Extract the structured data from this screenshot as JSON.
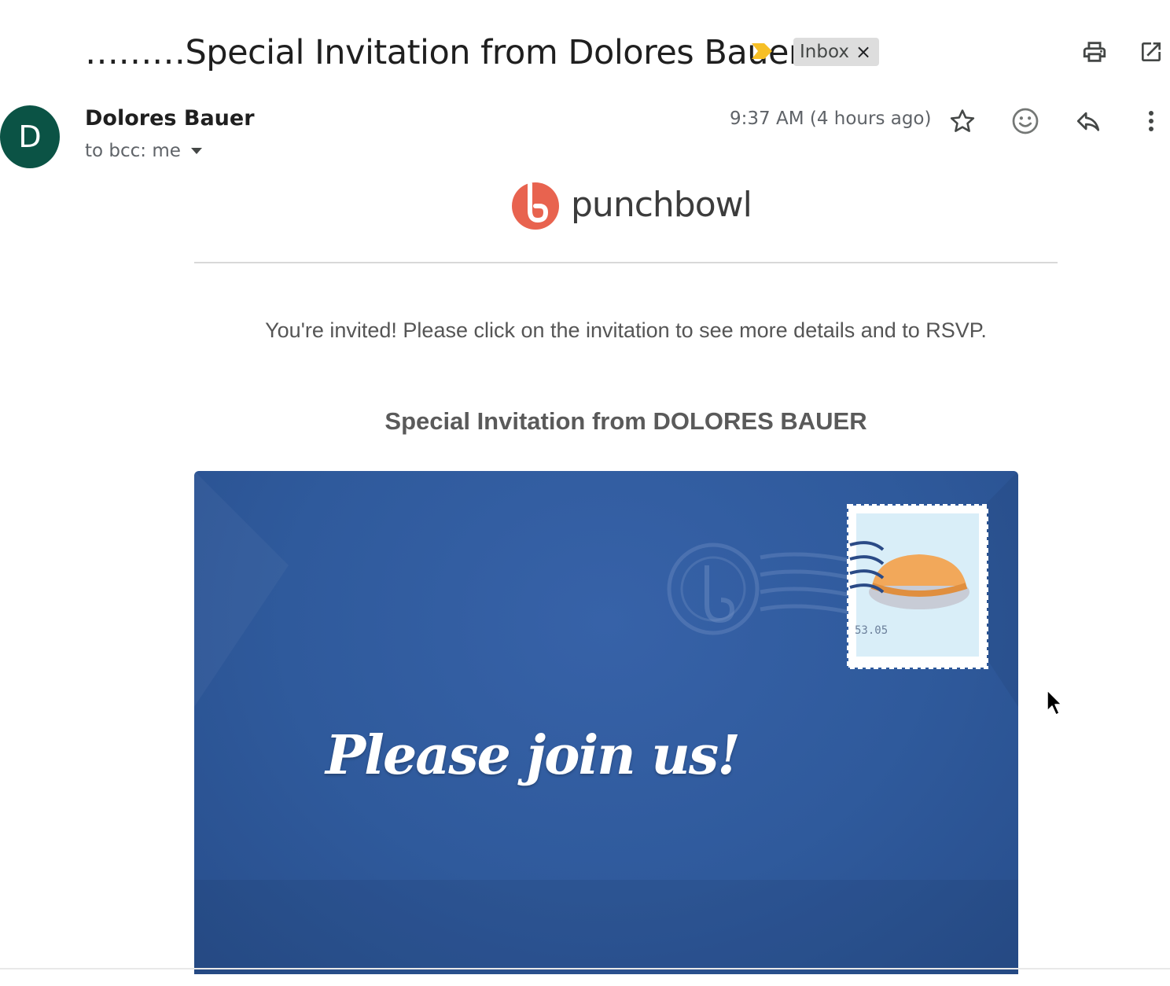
{
  "subject": "………Special Invitation from Dolores Bauer",
  "label": {
    "name": "Inbox",
    "remove": "×"
  },
  "sender": {
    "avatar_letter": "D",
    "name": "Dolores Bauer",
    "to": "to bcc: me",
    "timestamp": "9:37 AM (4 hours ago)"
  },
  "icons": {
    "important": "important-marker-icon",
    "print": "print-icon",
    "open_new_window": "open-in-new-window-icon",
    "star": "star-icon",
    "emoji": "emoji-reaction-icon",
    "reply": "reply-icon",
    "more": "more-vert-icon",
    "dropdown": "caret-down-icon"
  },
  "body": {
    "logo_text": "punchbowl",
    "intro": "You're invited! Please click on the invitation to see more details and to RSVP.",
    "invitation_title": "Special Invitation from DOLORES BAUER",
    "envelope_text": "Please join us!",
    "stamp_value": "53.05"
  },
  "colors": {
    "avatar_bg": "#0b5345",
    "important_marker": "#f6bf26",
    "punchbowl_logo": "#e8634f",
    "envelope_blue": "#2f5a9c"
  }
}
